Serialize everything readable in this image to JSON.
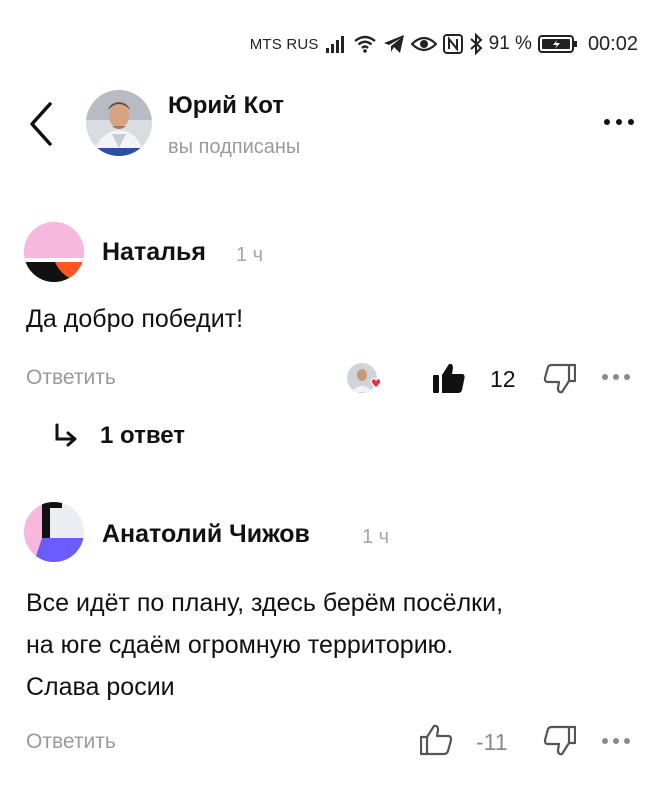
{
  "status_bar": {
    "carrier": "MTS RUS",
    "battery_text": "91 %",
    "time": "00:02"
  },
  "header": {
    "name": "Юрий Кот",
    "subtitle": "вы подписаны"
  },
  "comments": [
    {
      "author": "Наталья",
      "time": "1 ч",
      "text": "Да добро победит!",
      "reply_label": "Ответить",
      "likes": "12",
      "liked": true,
      "reaction_badge": "heart",
      "replies_label": "1 ответ"
    },
    {
      "author": "Анатолий Чижов",
      "time": "1 ч",
      "text_lines": [
        "Все идёт по плану, здесь берём посёлки,",
        "на юге сдаём огромную территорию.",
        "Слава росии"
      ],
      "reply_label": "Ответить",
      "likes": "-11",
      "liked": false
    }
  ],
  "colors": {
    "accent_orange": "#ff5722",
    "pink": "#f7b8de",
    "violet": "#6a5cff",
    "heart_red": "#e0323b"
  }
}
